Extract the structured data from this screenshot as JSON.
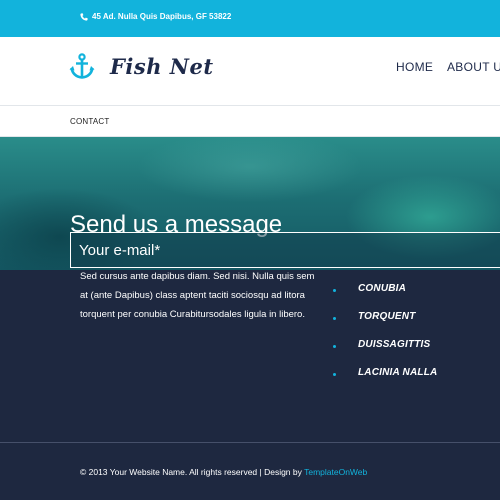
{
  "topbar": {
    "address": "45 Ad. Nulla Quis Dapibus, GF 53822",
    "icon": "phone-icon",
    "color": "#12b3dc"
  },
  "header": {
    "logo_icon": "anchor-icon",
    "logo_text": "Fish Net",
    "nav": [
      {
        "label": "HOME"
      },
      {
        "label": "ABOUT US"
      }
    ]
  },
  "subnav": {
    "contact_label": "CONTACT"
  },
  "hero": {
    "title": "Send us a message"
  },
  "form": {
    "email_placeholder": "Your e-mail*"
  },
  "content": {
    "paragraph": "Sed cursus ante dapibus diam. Sed nisi. Nulla quis sem at (ante Dapibus) class aptent taciti sociosqu ad litora torquent per conubia Curabitursodales ligula in libero.",
    "links": [
      {
        "label": "CONUBIA"
      },
      {
        "label": "TORQUENT"
      },
      {
        "label": "DUISSAGITTIS"
      },
      {
        "label": "LACINIA NALLA"
      }
    ]
  },
  "footer": {
    "copyright": "© 2013 Your Website Name. All rights reserved | Design by ",
    "design_link": "TemplateOnWeb"
  },
  "colors": {
    "accent": "#12b3dc",
    "dark": "#1e2840",
    "navy": "#1e2a4a"
  }
}
